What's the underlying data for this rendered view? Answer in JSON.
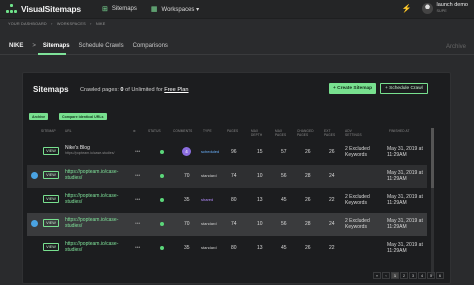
{
  "app": {
    "name": "VisualSitemaps"
  },
  "topnav": {
    "sitemaps": "Sitemaps",
    "workspaces": "Workspaces ▾"
  },
  "user": {
    "name": "launch demo",
    "plan": "SUPE"
  },
  "breadcrumb": [
    "YOUR DASHBOARD",
    "›",
    "WORKSPACES",
    "›",
    "NIKE"
  ],
  "tabs": {
    "brand": "NIKE",
    "sep": ">",
    "sitemaps": "Sitemaps",
    "schedule": "Schedule Crawls",
    "comparisons": "Comparisons",
    "archive": "Archive"
  },
  "panel": {
    "title": "Sitemaps",
    "crawled_prefix": "Crawled pages: ",
    "crawled_count": "0",
    "crawled_mid": " of Unlimited for ",
    "plan_link": "Free Plan",
    "create_button": "+ Create Sitemap",
    "schedule_button": "+ Schedule Crawl",
    "archive_chip": "Archive",
    "compare_chip": "Compare identical URLs"
  },
  "columns": [
    "SITEMAP",
    "URL",
    "STATUS",
    "COMMENTS",
    "TYPE",
    "PAGES",
    "MAX DEPTH",
    "MAX PAGES",
    "CHANGED PAGES",
    "EXT PAGES",
    "ADV SETTINGS",
    "FINISHED AT"
  ],
  "rows": [
    {
      "view": "VIEW",
      "title": "Nike's Blog",
      "sub": "https://popteam.io/case-studies/",
      "comments": "4",
      "type": "scheduled",
      "pages": "96",
      "depth": "15",
      "maxp": "57",
      "changed": "26",
      "ext": "26",
      "kw": "2 Excluded Keywords",
      "finished": "May 31, 2019 at 11:29AM"
    },
    {
      "view": "VIEW",
      "url": "https://popteam.io/case-studies/",
      "comments": "70",
      "type": "standard",
      "pages": "74",
      "depth": "10",
      "maxp": "56",
      "changed": "28",
      "ext": "24",
      "kw": "",
      "finished": "May 31, 2019 at 11:29AM"
    },
    {
      "view": "VIEW",
      "url": "https://popteam.io/case-studies/",
      "comments": "35",
      "type": "shared",
      "pages": "80",
      "depth": "13",
      "maxp": "45",
      "changed": "26",
      "ext": "22",
      "kw": "2 Excluded Keywords",
      "finished": "May 31, 2019 at 11:29AM"
    },
    {
      "view": "VIEW",
      "url": "https://popteam.io/case-studies/",
      "comments": "70",
      "type": "standard",
      "pages": "74",
      "depth": "10",
      "maxp": "56",
      "changed": "28",
      "ext": "24",
      "kw": "2 Excluded Keywords",
      "finished": "May 31, 2019 at 11:29AM"
    },
    {
      "view": "VIEW",
      "url": "https://popteam.io/case-studies/",
      "comments": "35",
      "type": "standard",
      "pages": "80",
      "depth": "13",
      "maxp": "45",
      "changed": "26",
      "ext": "22",
      "kw": "",
      "finished": "May 31, 2019 at 11:29AM"
    }
  ],
  "pager": [
    "«",
    "‹",
    "1",
    "2",
    "3",
    "4",
    "5",
    "6"
  ]
}
